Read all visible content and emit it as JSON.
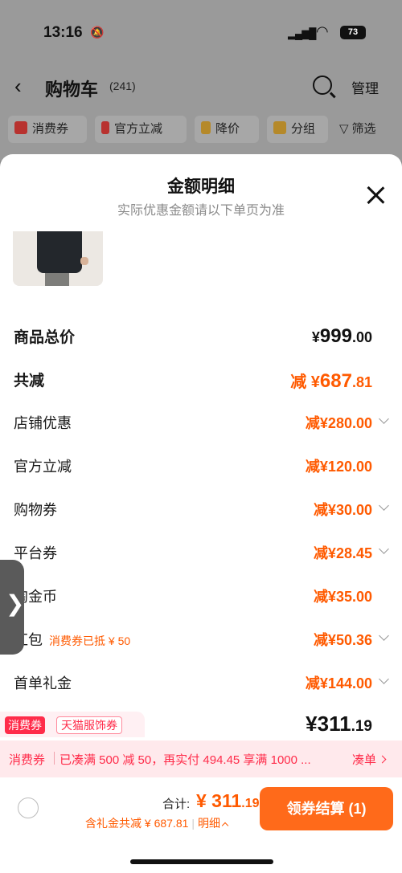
{
  "status": {
    "time": "13:16",
    "battery": "73"
  },
  "navbar": {
    "back": "‹",
    "title": "购物车",
    "count": "(241)",
    "manage": "管理"
  },
  "chips": [
    "消费券",
    "官方立减",
    "降价",
    "分组",
    "筛选"
  ],
  "sheet": {
    "title": "金额明细",
    "subtitle": "实际优惠金额请以下单页为准",
    "rows": [
      {
        "label": "商品总价",
        "value_prefix": "¥",
        "value_int": "999",
        "value_dec": ".00"
      },
      {
        "label": "共减",
        "value_prefix": "减 ¥",
        "value_int": "687",
        "value_dec": ".81"
      },
      {
        "label": "店铺优惠",
        "value": "减¥280.00"
      },
      {
        "label": "官方立减",
        "value": "减¥120.00"
      },
      {
        "label": "购物券",
        "value": "减¥30.00"
      },
      {
        "label": "平台券",
        "value": "减¥28.45"
      },
      {
        "label": "淘金币",
        "value": "减¥35.00"
      },
      {
        "label": "红包",
        "note": "消费券已抵 ¥ 50",
        "value": "减¥50.36"
      },
      {
        "label": "首单礼金",
        "value": "减¥144.00"
      }
    ],
    "tag_consumer": "消费券",
    "tag_tmall": "天猫服饰券",
    "final_int": "¥311",
    "final_dec": ".19"
  },
  "promo": {
    "label": "消费券",
    "text": "已凑满 500 减 50，再实付 494.45 享满 1000 ...",
    "action": "凑单"
  },
  "bottom": {
    "total_label": "合计:",
    "total_int": "¥ 311",
    "total_dec": ".19",
    "sub_text": "含礼金共减 ¥ 687.81",
    "detail": "明细",
    "checkout": "领券结算 (1)"
  },
  "colors": {
    "accent": "#ff5a00",
    "red": "#ff2c4a",
    "checkout": "#ff6a1a"
  }
}
